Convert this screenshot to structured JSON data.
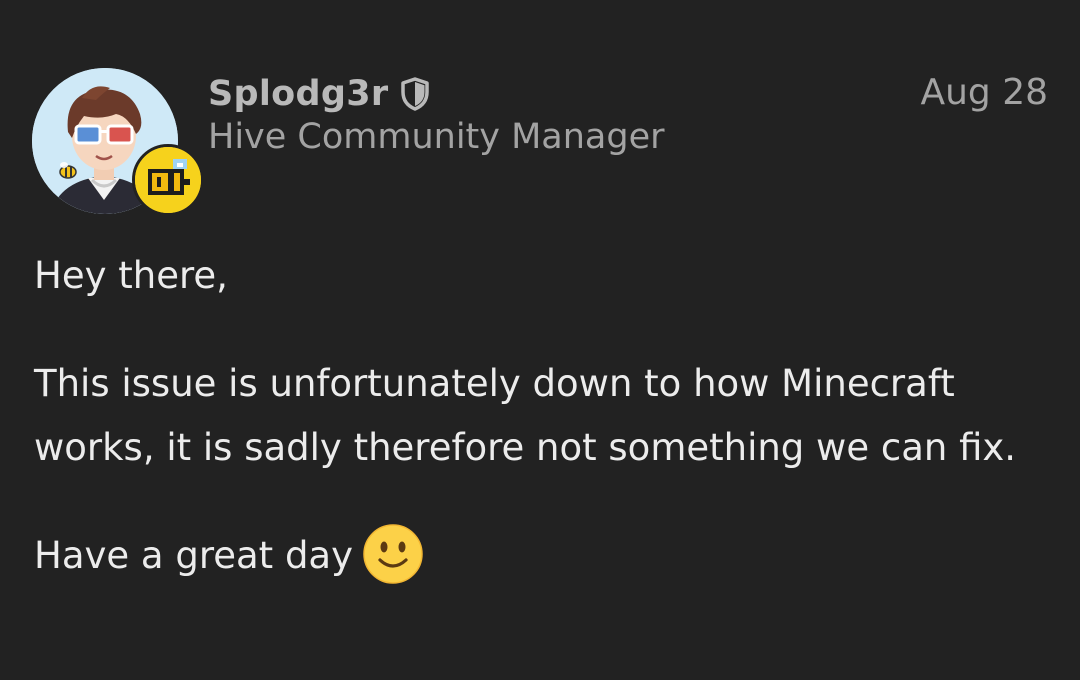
{
  "post": {
    "author": {
      "username": "Splodg3r",
      "title": "Hive Community Manager",
      "avatar_icon": "avatar-cartoon-boy-3d-glasses",
      "badge_icon": "bee-pixel-badge-icon",
      "shield_icon": "shield-icon"
    },
    "date": "Aug 28",
    "body": {
      "greeting": "Hey there,",
      "message": "This issue is unfortunately down to how Minecraft works, it is sadly therefore not something we can fix.",
      "signoff": "Have a great day",
      "signoff_emoji": "slightly-smiling-face-icon"
    }
  },
  "colors": {
    "background": "#222222",
    "username": "#b9b9b9",
    "meta": "#a3a3a3",
    "text": "#ececec",
    "badge": "#f6d21c"
  }
}
